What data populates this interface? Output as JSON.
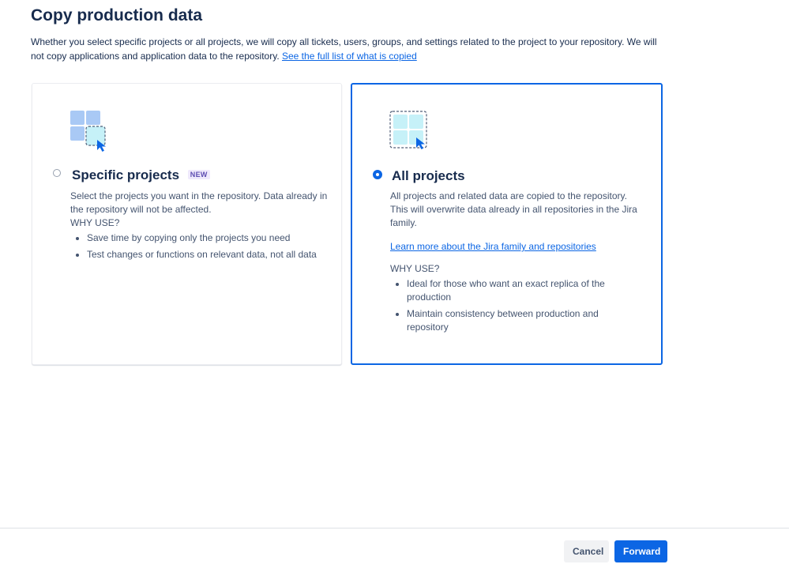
{
  "page": {
    "title": "Copy production data",
    "intro_text": "Whether you select specific projects or all projects, we will copy all tickets, users, groups, and settings related to the project to your repository. We will not copy applications and application data to the repository.",
    "intro_link": "See the full list of what is copied"
  },
  "options": {
    "specific": {
      "title": "Specific projects",
      "badge": "NEW",
      "selected": false,
      "description": "Select the projects you want in the repository. Data already in the repository will not be affected.",
      "why_label": "WHY USE?",
      "bullets": [
        "Save time by copying only the projects you need",
        "Test changes or functions on relevant data, not all data"
      ]
    },
    "all": {
      "title": "All projects",
      "selected": true,
      "description": "All projects and related data are copied to the repository. This will overwrite data already in all repositories in the Jira family.",
      "link": "Learn more about the Jira family and repositories",
      "why_label": "WHY USE?",
      "bullets": [
        "Ideal for those who want an exact replica of the production",
        "Maintain consistency between production and repository"
      ]
    }
  },
  "footer": {
    "cancel_label": "Cancel",
    "forward_label": "Forward"
  },
  "colors": {
    "accent": "#0c66e4",
    "text": "#172b4d",
    "badge_bg": "#efe9fc",
    "badge_text": "#5e4db2"
  },
  "icons": {
    "specific": "project-grid-select-icon",
    "all": "all-projects-grid-icon"
  }
}
